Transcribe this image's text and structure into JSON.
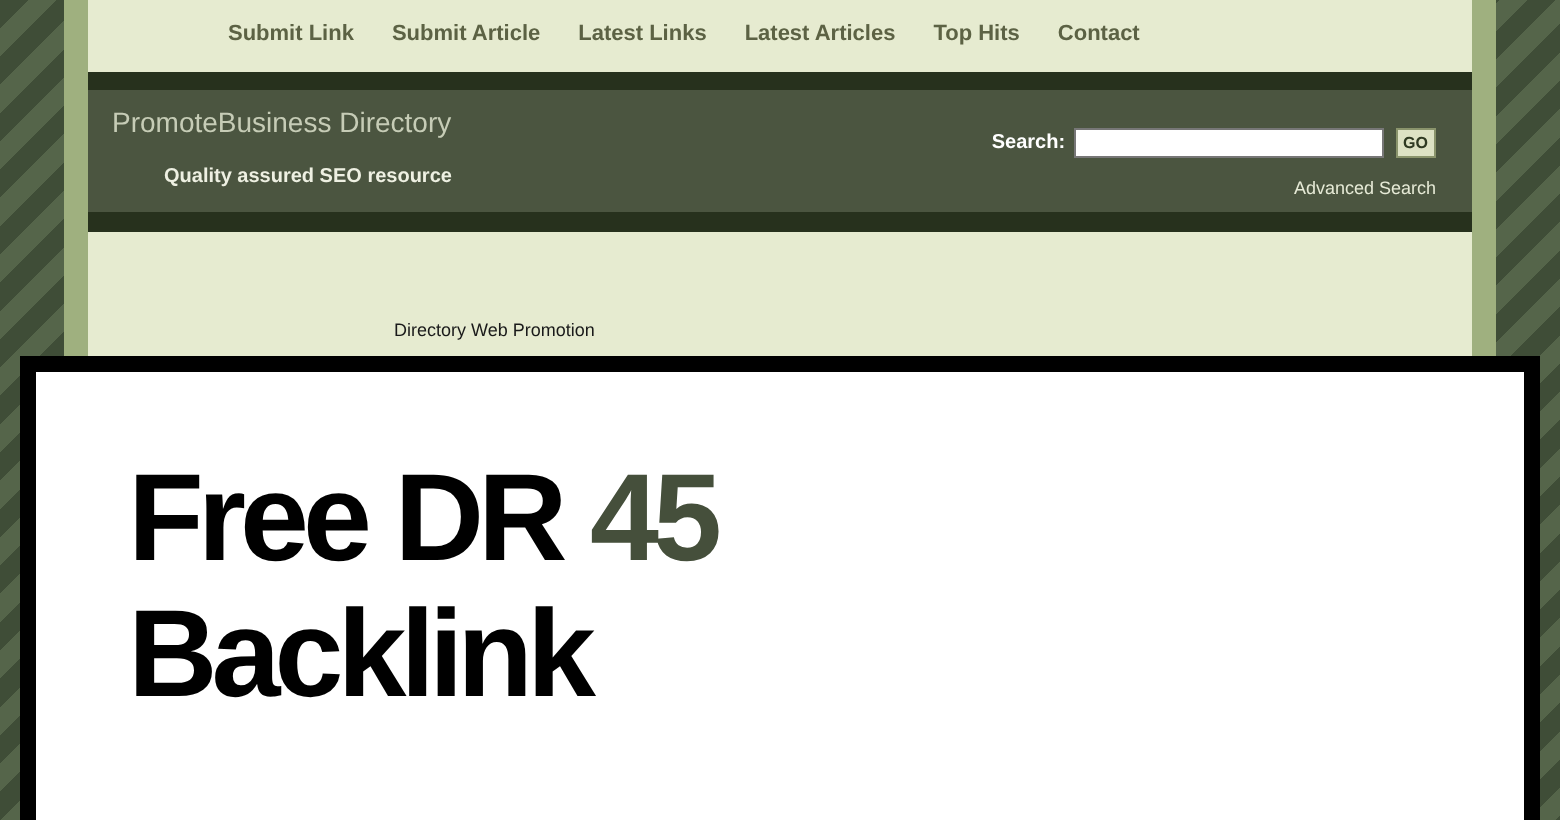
{
  "nav": [
    "Submit Link",
    "Submit Article",
    "Latest Links",
    "Latest Articles",
    "Top Hits",
    "Contact"
  ],
  "header": {
    "title": "PromoteBusiness Directory",
    "tagline": "Quality assured SEO resource",
    "search_label": "Search:",
    "go_button": "GO",
    "advanced_link": "Advanced Search"
  },
  "content": {
    "link": "Directory Web Promotion"
  },
  "overlay": {
    "headline_start": "Free DR",
    "headline_number": "45",
    "headline_end": "Backlink"
  }
}
